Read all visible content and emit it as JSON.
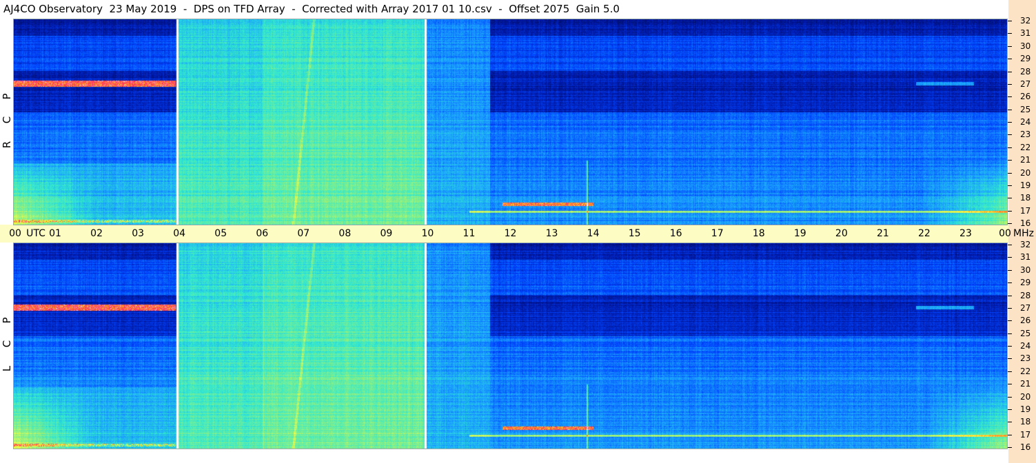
{
  "title": "AJ4CO Observatory  23 May 2019  -  DPS on TFD Array  -  Corrected with Array 2017 01 10.csv  -  Offset 2075  Gain 5.0",
  "chart_data": {
    "type": "heatmap",
    "xlabel": "UTC",
    "ylabel_unit": "MHz",
    "x_ticks": [
      "00",
      "01",
      "02",
      "03",
      "04",
      "05",
      "06",
      "07",
      "08",
      "09",
      "10",
      "11",
      "12",
      "13",
      "14",
      "15",
      "16",
      "17",
      "18",
      "19",
      "20",
      "21",
      "22",
      "23",
      "00"
    ],
    "y_ticks": [
      "16",
      "17",
      "18",
      "19",
      "20",
      "21",
      "22",
      "23",
      "24",
      "25",
      "26",
      "27",
      "28",
      "29",
      "30",
      "31",
      "32"
    ],
    "x_range_hours": [
      0,
      24
    ],
    "y_range_mhz": [
      16,
      32
    ],
    "markers_utc_hours": [
      3.93,
      9.93
    ],
    "colormap": [
      "#000a33",
      "#0016a0",
      "#0044ff",
      "#1aa0ff",
      "#30e8d0",
      "#90f080",
      "#ffff40",
      "#ff9020",
      "#ff2060",
      "#ffffff"
    ],
    "panels": [
      {
        "label_letters": [
          "R",
          "C",
          "P"
        ]
      },
      {
        "label_letters": [
          "L",
          "C",
          "P"
        ]
      }
    ]
  },
  "axis_text": {
    "utc": "UTC",
    "mhz": "MHz"
  }
}
